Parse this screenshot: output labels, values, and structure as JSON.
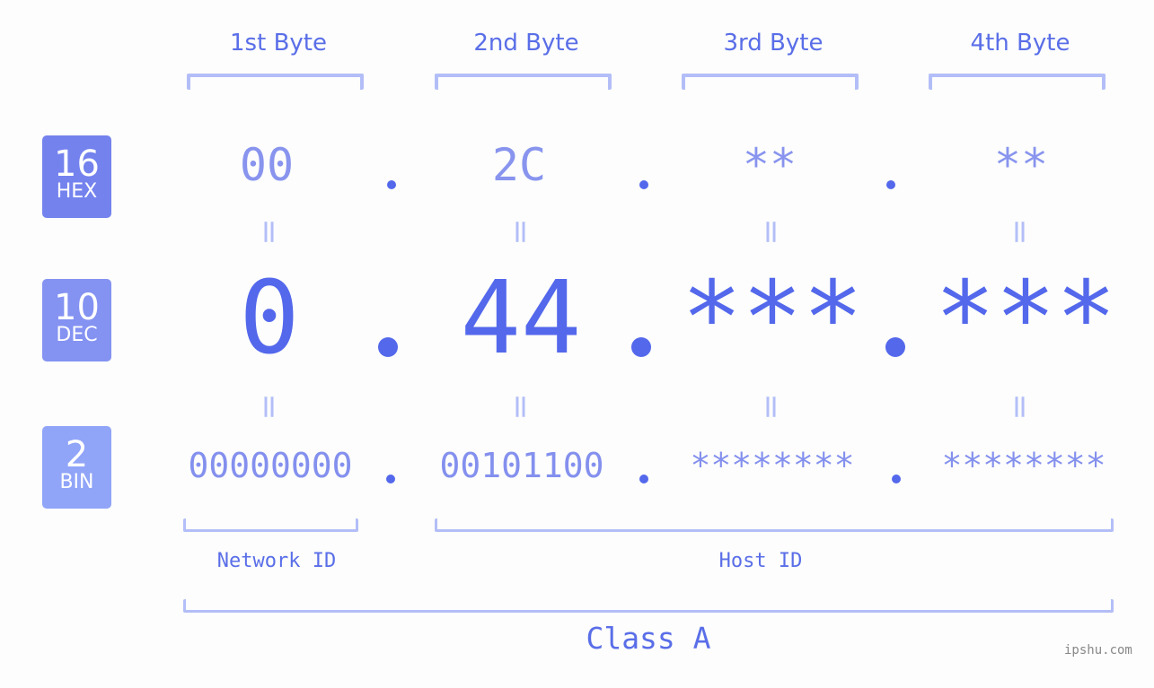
{
  "bytes": [
    {
      "label": "1st Byte",
      "hex": "00",
      "dec": "0",
      "bin": "00000000"
    },
    {
      "label": "2nd Byte",
      "hex": "2C",
      "dec": "44",
      "bin": "00101100"
    },
    {
      "label": "3rd Byte",
      "hex": "**",
      "dec": "***",
      "bin": "********"
    },
    {
      "label": "4th Byte",
      "hex": "**",
      "dec": "***",
      "bin": "********"
    }
  ],
  "badges": {
    "hex": {
      "num": "16",
      "label": "HEX",
      "color": "#7482ee"
    },
    "dec": {
      "num": "10",
      "label": "DEC",
      "color": "#8492f2"
    },
    "bin": {
      "num": "2",
      "label": "BIN",
      "color": "#90a4f8"
    }
  },
  "equals_symbol": "=",
  "network_id_label": "Network ID",
  "host_id_label": "Host ID",
  "class_label": "Class A",
  "watermark": "ipshu.com",
  "colors": {
    "accent": "#5468ec",
    "light_accent": "#8894ee",
    "bracket": "#b3bef8"
  }
}
